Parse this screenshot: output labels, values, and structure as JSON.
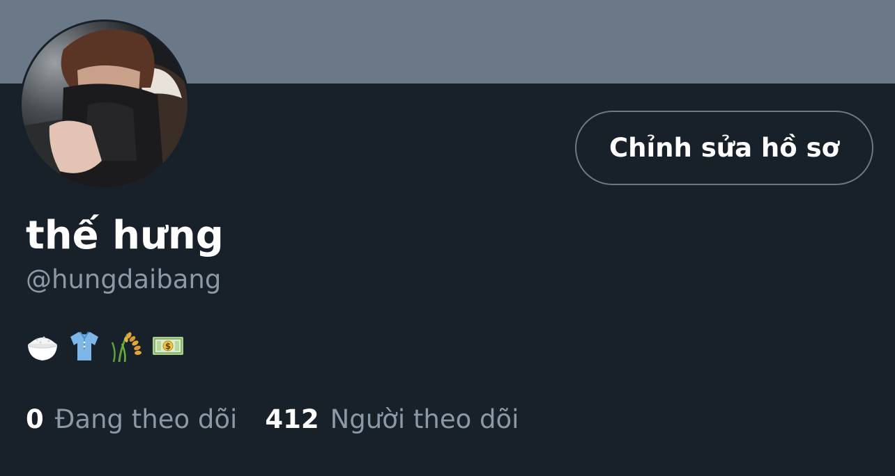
{
  "profile": {
    "display_name": "thế hưng",
    "handle": "@hungdaibang",
    "bio_emojis": [
      "rice-bowl-icon",
      "t-shirt-icon",
      "rice-ear-icon",
      "dollar-banknote-icon"
    ],
    "edit_button_label": "Chỉnh sửa hồ sơ"
  },
  "stats": {
    "following_count": "0",
    "following_label": "Đang theo dõi",
    "followers_count": "412",
    "followers_label": "Người theo dõi"
  },
  "colors": {
    "banner": "#6b7887",
    "background": "#182029",
    "primary_text": "#ffffff",
    "secondary_text": "#8b98a5"
  }
}
